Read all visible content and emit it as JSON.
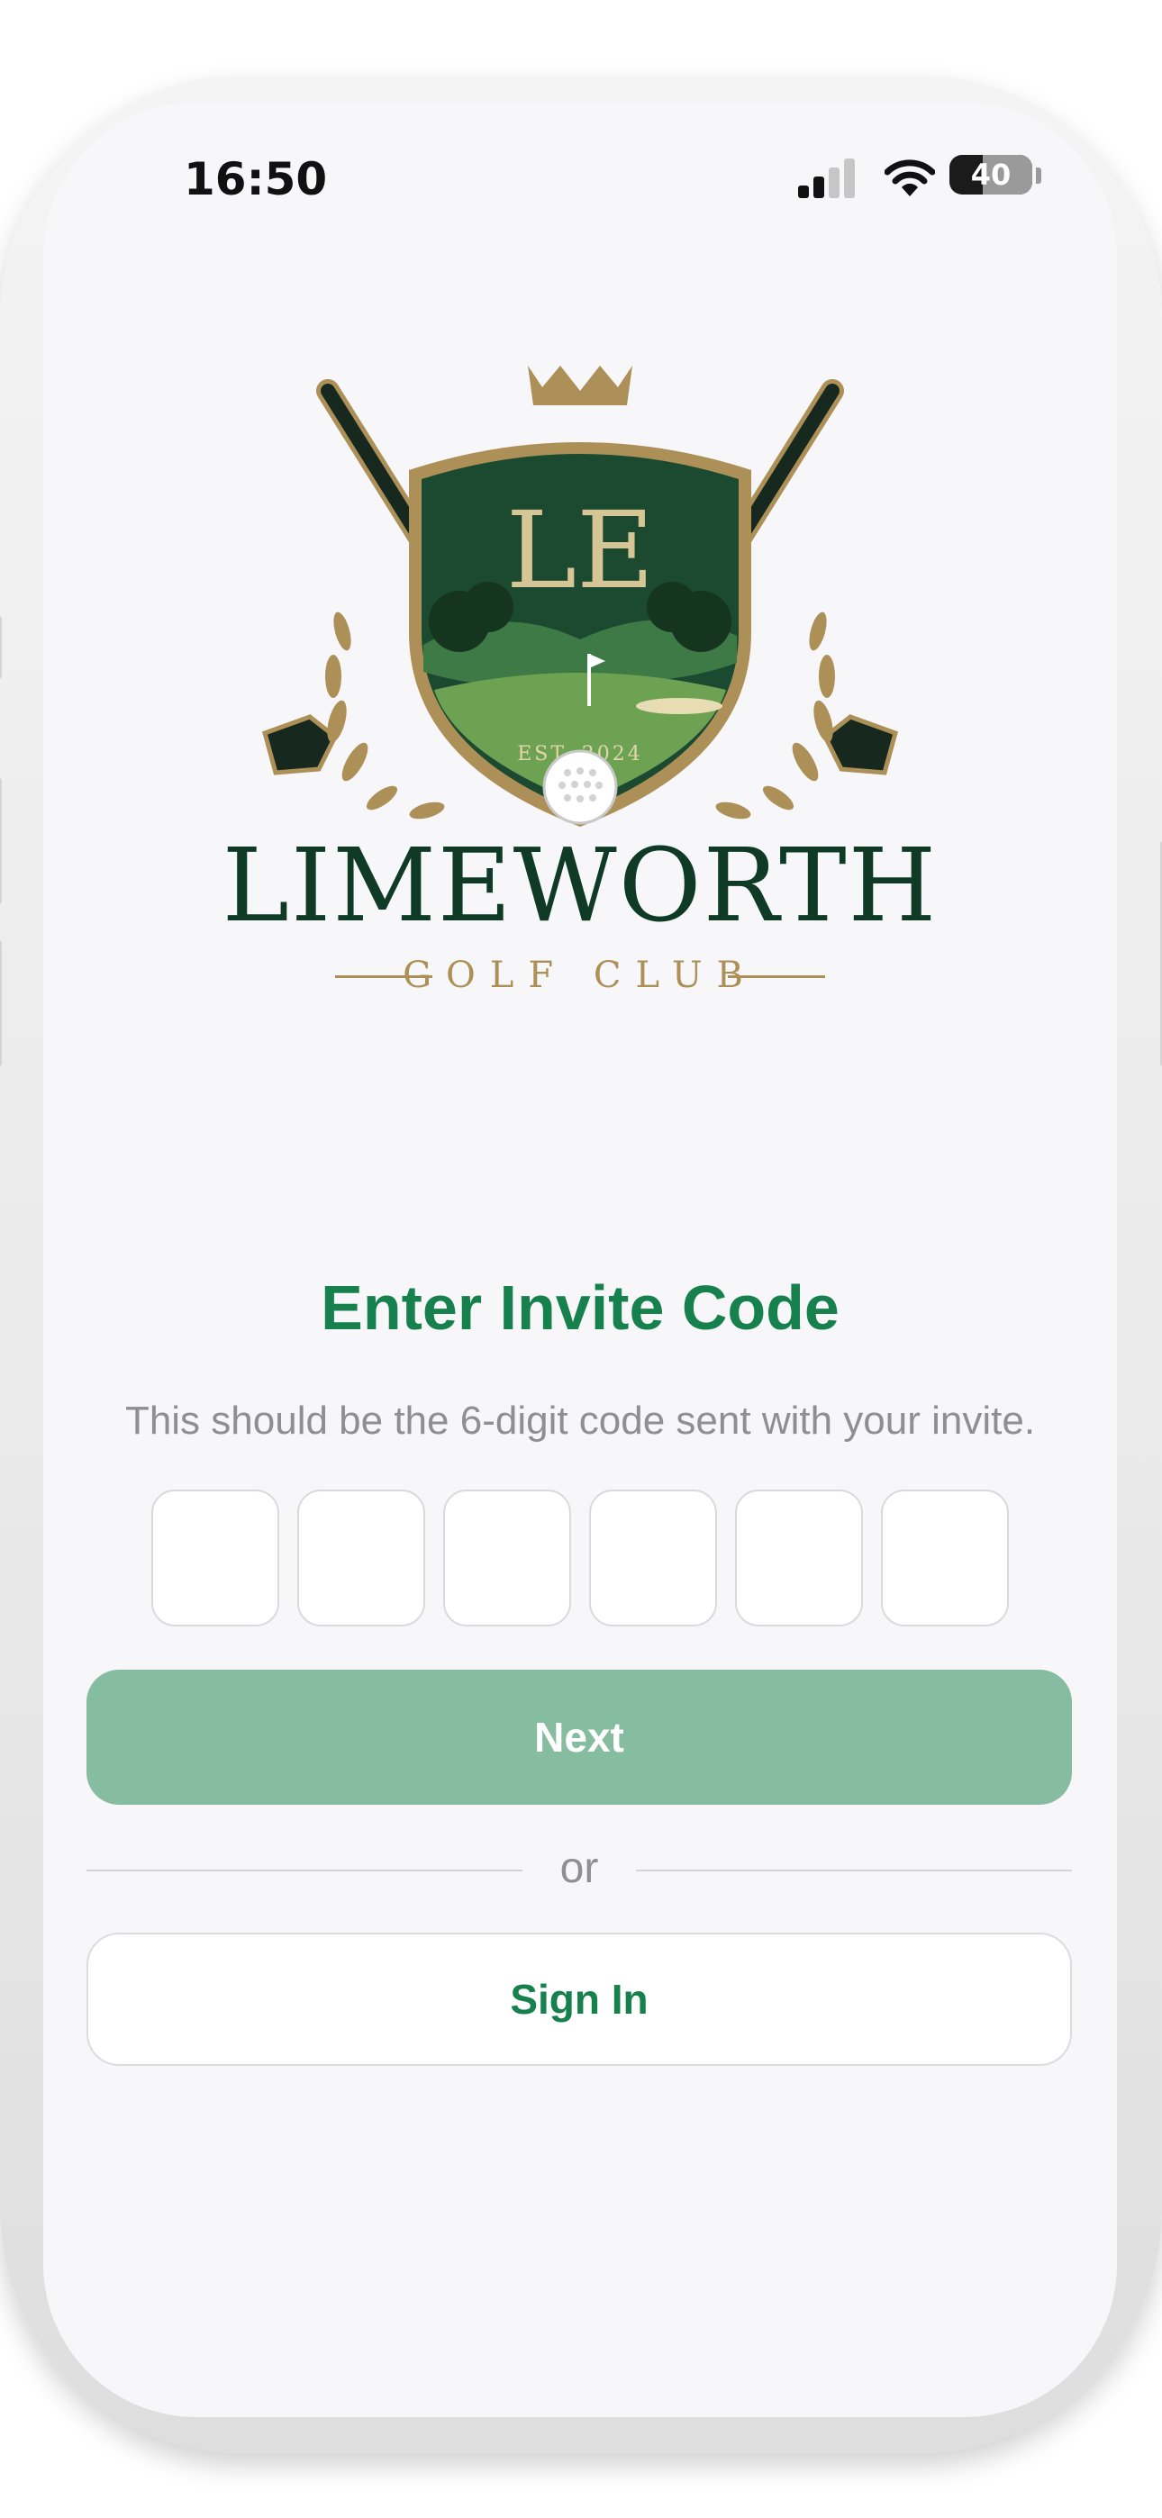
{
  "status_bar": {
    "time": "16:50",
    "battery_level": "40",
    "battery_fraction": 0.4,
    "signal_bars_active": 2,
    "icons": [
      "signal-icon",
      "wifi-icon",
      "battery-icon"
    ]
  },
  "logo": {
    "monogram": "LE",
    "established": "EST. 2024",
    "name": "LIMEWORTH",
    "subtitle": "GOLF CLUB"
  },
  "colors": {
    "brand_green": "#17814e",
    "button_green_disabled": "#86bda0",
    "crest_green": "#1b4a30",
    "gold": "#ad9058",
    "muted_text": "#8e8e93"
  },
  "invite": {
    "title": "Enter Invite Code",
    "description": "This should be the 6-digit code sent with your invite.",
    "code_digits": [
      "",
      "",
      "",
      "",
      "",
      ""
    ]
  },
  "actions": {
    "next_label": "Next",
    "or_label": "or",
    "sign_in_label": "Sign In"
  }
}
